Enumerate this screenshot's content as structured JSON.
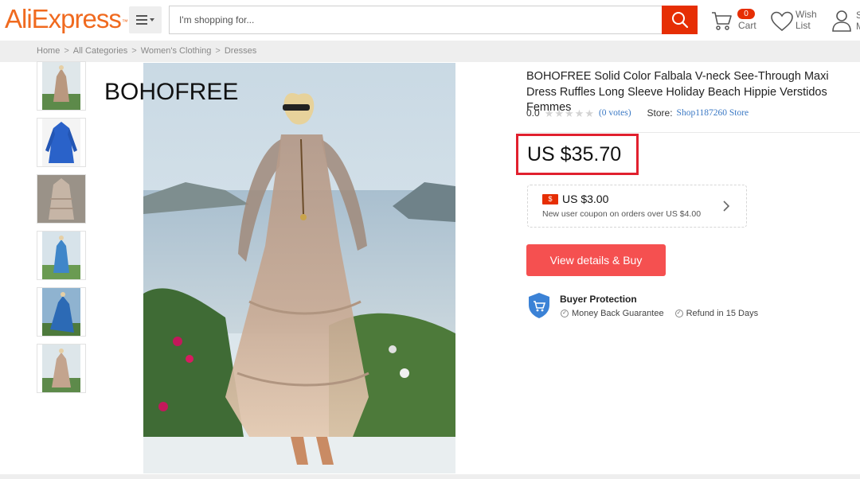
{
  "header": {
    "logo_text": "AliExpress",
    "logo_tm": "™",
    "search_placeholder": "I'm shopping for...",
    "cart_count": "0",
    "cart_label": "Cart",
    "wish_label_1": "Wish",
    "wish_label_2": "List",
    "account_label_1": "S",
    "account_label_2": "M"
  },
  "breadcrumb": {
    "items": [
      "Home",
      "All Categories",
      "Women's Clothing",
      "Dresses"
    ],
    "separator": ">"
  },
  "gallery": {
    "brand_overlay": "BOHOFREE",
    "thumbnail_count": 6
  },
  "product": {
    "title": "BOHOFREE Solid Color Falbala V-neck See-Through Maxi Dress Ruffles Long Sleeve Holiday Beach Hippie Verstidos Femmes",
    "rating": "0.0",
    "votes": "(0 votes)",
    "store_label": "Store:",
    "store_name": "Shop1187260 Store",
    "price": "US $35.70"
  },
  "coupon": {
    "badge": "$",
    "amount": "US $3.00",
    "description": "New user coupon on orders over US $4.00"
  },
  "actions": {
    "buy_label": "View details & Buy"
  },
  "protection": {
    "title": "Buyer Protection",
    "items": [
      "Money Back Guarantee",
      "Refund in 15 Days"
    ]
  },
  "colors": {
    "brand_orange": "#f06a1f",
    "search_red": "#e62e04",
    "buy_button": "#f55050",
    "price_border": "#e1202e",
    "link_blue": "#3a78c4"
  }
}
